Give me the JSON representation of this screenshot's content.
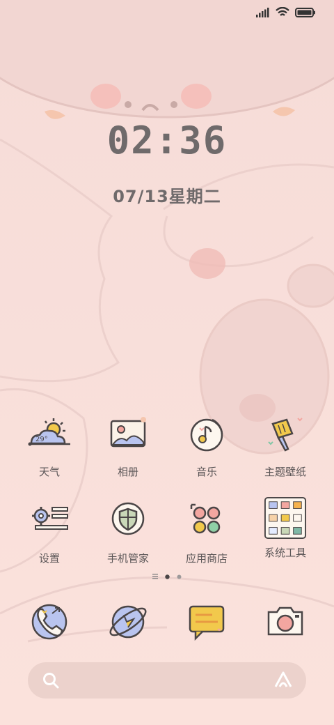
{
  "status_bar": {
    "icons": [
      "signal-icon",
      "wifi-icon",
      "battery-icon"
    ]
  },
  "clock": {
    "time": "02:36",
    "date": "07/13星期二"
  },
  "apps": [
    {
      "label": "天气",
      "icon": "weather-icon",
      "temperature": "29°"
    },
    {
      "label": "相册",
      "icon": "gallery-icon"
    },
    {
      "label": "音乐",
      "icon": "music-icon"
    },
    {
      "label": "主题壁纸",
      "icon": "theme-brush-icon"
    },
    {
      "label": "设置",
      "icon": "settings-icon"
    },
    {
      "label": "手机管家",
      "icon": "security-shield-icon"
    },
    {
      "label": "应用商店",
      "icon": "app-store-icon"
    },
    {
      "label": "系统工具",
      "icon": "system-tools-folder-icon"
    }
  ],
  "page_indicator": {
    "pages": 3,
    "current": 1
  },
  "dock": [
    "phone-icon",
    "browser-icon",
    "messages-icon",
    "camera-icon"
  ],
  "search_bar": {
    "icons": [
      "search-icon",
      "assistant-icon"
    ]
  },
  "colors": {
    "background": "#f8dcd8",
    "text": "#5b5657",
    "clock": "#6f6a6b",
    "outline": "#4a4546",
    "accent_yellow": "#f2c94c",
    "accent_blue": "#b9c4ef",
    "accent_pink": "#f3a6a0"
  }
}
